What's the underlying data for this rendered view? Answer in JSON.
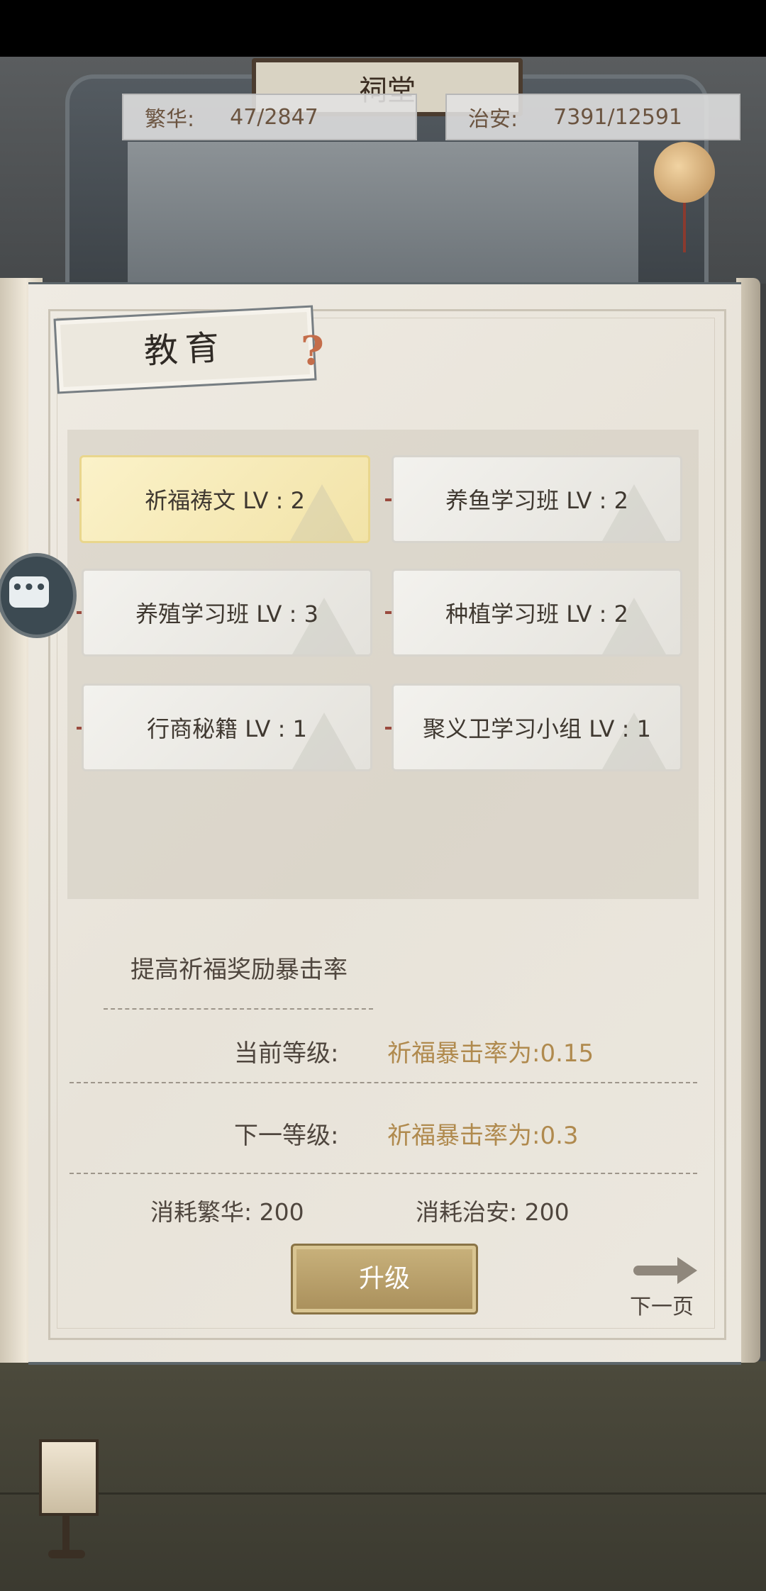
{
  "scene": {
    "plaque_title": "祠堂"
  },
  "stats": {
    "prosperity_label": "繁华:",
    "prosperity_value": "47/2847",
    "security_label": "治安:",
    "security_value": "7391/12591"
  },
  "panel": {
    "title": "教育",
    "help_glyph": "?",
    "skills": [
      {
        "label": "祈福祷文 LV : 2",
        "active": true
      },
      {
        "label": "养鱼学习班 LV : 2",
        "active": false
      },
      {
        "label": "养殖学习班 LV : 3",
        "active": false
      },
      {
        "label": "种植学习班 LV : 2",
        "active": false
      },
      {
        "label": "行商秘籍 LV : 1",
        "active": false
      },
      {
        "label": "聚义卫学习小组 LV : 1",
        "active": false
      }
    ]
  },
  "detail": {
    "description": "提高祈福奖励暴击率",
    "current_label": "当前等级:",
    "current_value": "祈福暴击率为:0.15",
    "next_label": "下一等级:",
    "next_value": "祈福暴击率为:0.3",
    "cost_prosperity": "消耗繁华: 200",
    "cost_security": "消耗治安: 200"
  },
  "actions": {
    "upgrade_label": "升级",
    "next_page_label": "下一页"
  },
  "chat": {
    "icon_glyph": "•••"
  },
  "colors": {
    "accent_gold": "#b08a4e",
    "active_card": "#f2e3a8",
    "button": "#b89d66"
  }
}
